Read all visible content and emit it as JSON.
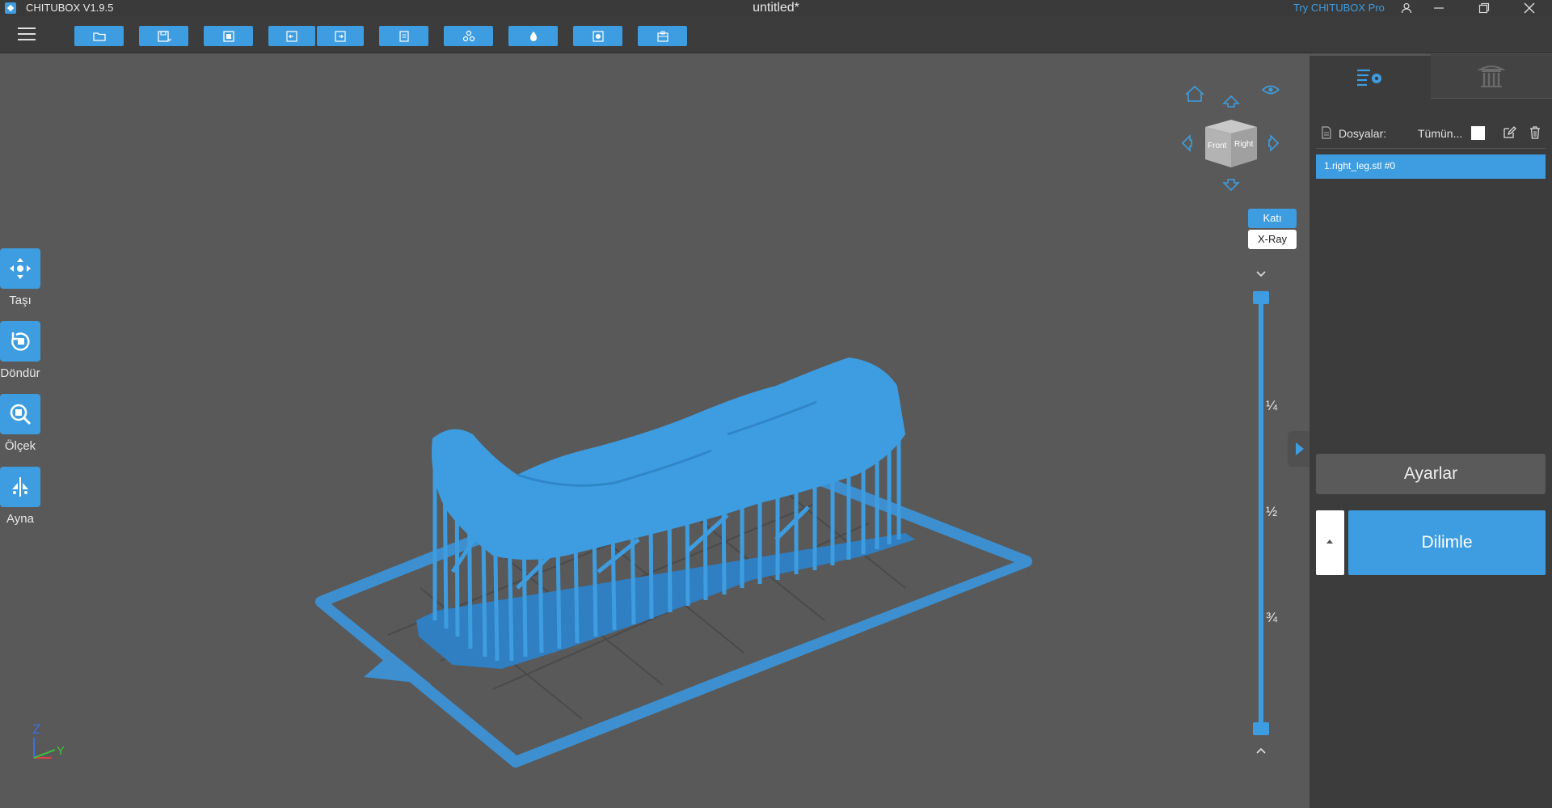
{
  "titlebar": {
    "app_title": "CHITUBOX V1.9.5",
    "doc_title": "untitled*",
    "try_pro": "Try CHITUBOX Pro"
  },
  "toolbar": {
    "buttons": [
      "open-folder-icon",
      "save-icon",
      "screenshot-icon",
      "undo-icon",
      "redo-icon",
      "copy-icon",
      "arrange-icon",
      "hollow-icon",
      "drill-icon",
      "settings-icon"
    ]
  },
  "tools": {
    "move": "Taşı",
    "rotate": "Döndür",
    "scale": "Ölçek",
    "mirror": "Ayna"
  },
  "navcube": {
    "front": "Front",
    "right": "Right"
  },
  "render_mode": {
    "solid": "Katı",
    "xray": "X-Ray"
  },
  "layer_slider": {
    "ticks": [
      "¼",
      "½",
      "¾"
    ]
  },
  "axes": {
    "z": "Z",
    "y": "Y"
  },
  "panel": {
    "files_label": "Dosyalar:",
    "all_label": "Tümün...",
    "files": [
      "1.right_leg.stl #0"
    ],
    "settings_label": "Ayarlar",
    "slice_label": "Dilimle"
  },
  "colors": {
    "accent": "#3d9de0",
    "background": "#595959",
    "panel": "#3c3c3c"
  }
}
